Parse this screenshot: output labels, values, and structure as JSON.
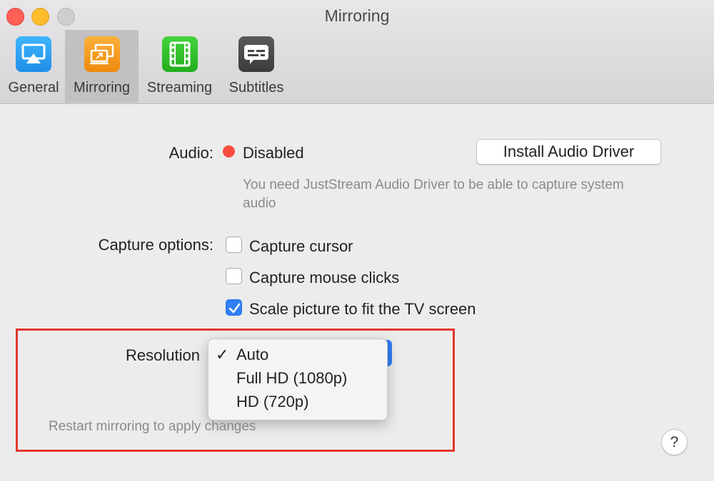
{
  "window": {
    "title": "Mirroring"
  },
  "tabs": [
    {
      "label": "General",
      "icon": "airplay-icon",
      "color": "#1f9bf0"
    },
    {
      "label": "Mirroring",
      "icon": "mirroring-icon",
      "color": "#f59a1b",
      "selected": true
    },
    {
      "label": "Streaming",
      "icon": "film-icon",
      "color": "#35c32f"
    },
    {
      "label": "Subtitles",
      "icon": "subtitles-icon",
      "color": "#4a4a4a"
    }
  ],
  "audio": {
    "label": "Audio:",
    "status": "Disabled",
    "status_color": "#fb4d3f",
    "install_button": "Install Audio Driver",
    "hint": "You need JustStream Audio Driver to be able to capture system audio"
  },
  "capture": {
    "label": "Capture options:",
    "options": [
      {
        "label": "Capture cursor",
        "checked": false
      },
      {
        "label": "Capture mouse clicks",
        "checked": false
      },
      {
        "label": "Scale picture to fit the TV screen",
        "checked": true
      }
    ]
  },
  "resolution": {
    "label": "Resolution",
    "selected": "Auto",
    "options": [
      {
        "label": "Auto",
        "check": "✓"
      },
      {
        "label": "Full HD (1080p)",
        "check": ""
      },
      {
        "label": "HD (720p)",
        "check": ""
      }
    ],
    "note": "Restart mirroring to apply changes"
  },
  "help": {
    "label": "?"
  },
  "colors": {
    "accent": "#2f7ff6",
    "highlight": "#e2372b"
  }
}
